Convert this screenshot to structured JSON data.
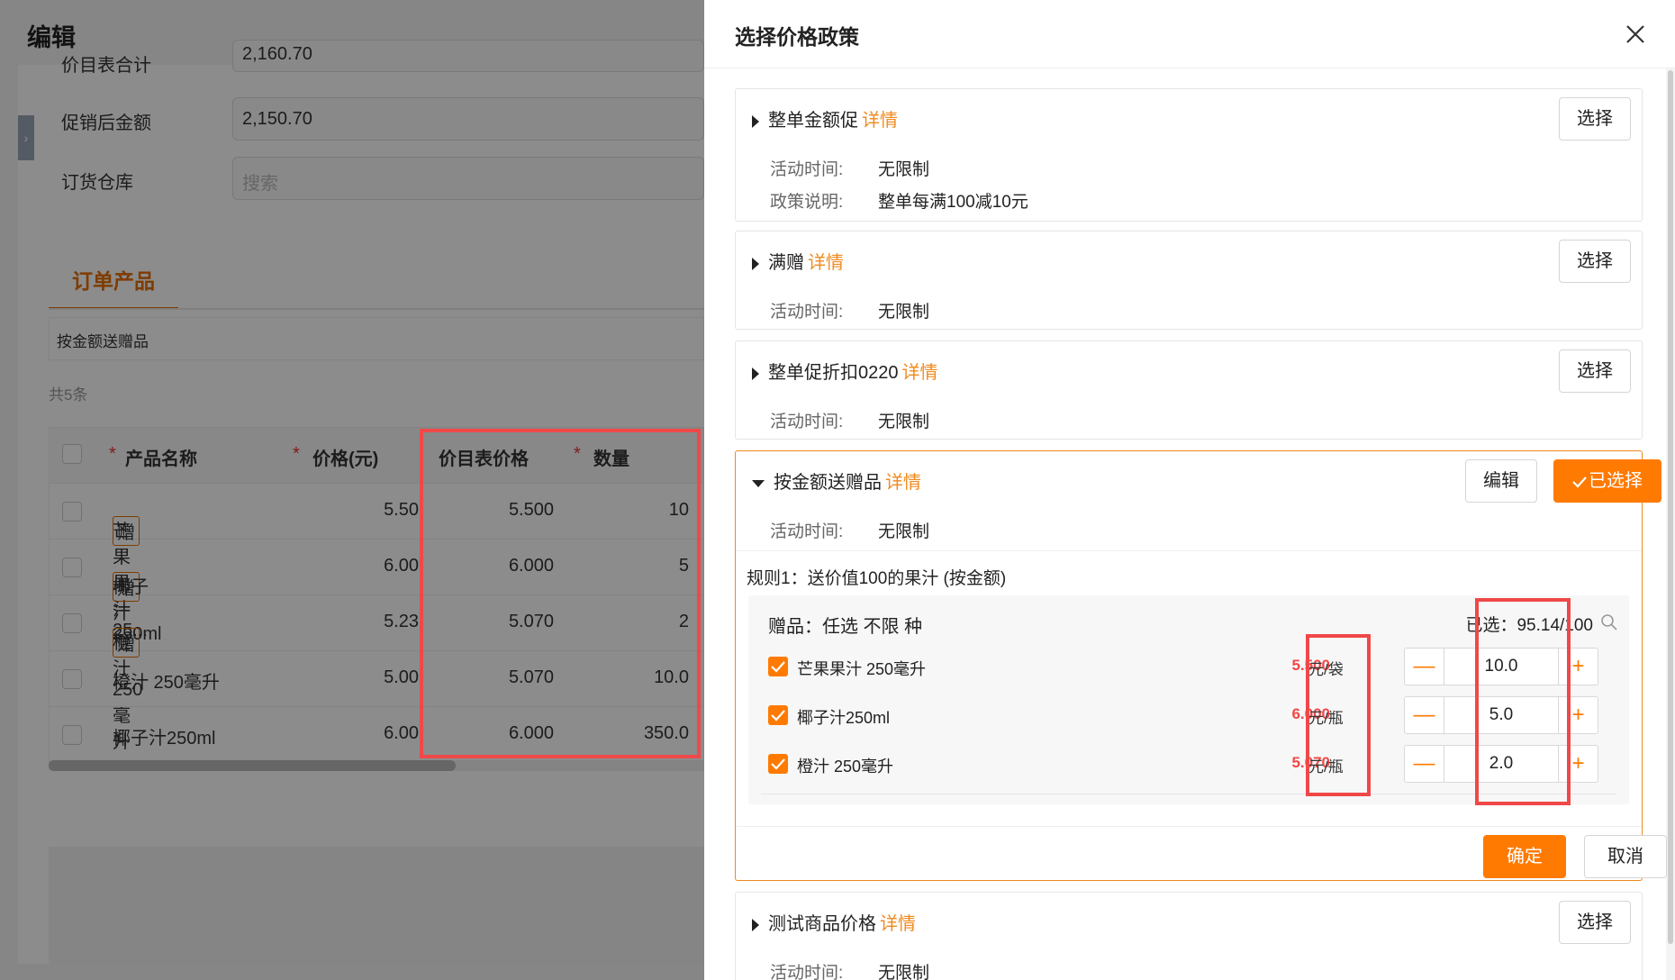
{
  "background": {
    "title": "编辑",
    "side_toggle": "›",
    "form": [
      {
        "label": "价目表合计",
        "value": "2,160.70"
      },
      {
        "label": "促销后金额",
        "value": "2,150.70"
      },
      {
        "label": "订货仓库",
        "placeholder": "搜索"
      }
    ],
    "tab": "订单产品",
    "filter_text": "按金额送赠品",
    "count": "共5条",
    "table": {
      "headers": {
        "name": "产品名称",
        "price": "价格(元)",
        "list_price": "价目表价格",
        "qty": "数量",
        "required_mark": "*"
      },
      "rows": [
        {
          "gift": "赠",
          "name": "芒果果汁 25...",
          "price": "5.50",
          "list_price": "5.500",
          "qty": "10"
        },
        {
          "gift": "赠",
          "name": "椰子汁250ml",
          "price": "6.00",
          "list_price": "6.000",
          "qty": "5"
        },
        {
          "gift": "赠",
          "name": "橙汁 250毫升",
          "price": "5.23",
          "list_price": "5.070",
          "qty": "2"
        },
        {
          "gift": "",
          "name": "橙汁 250毫升",
          "price": "5.00",
          "list_price": "5.070",
          "qty": "10.0"
        },
        {
          "gift": "",
          "name": "椰子汁250ml",
          "price": "6.00",
          "list_price": "6.000",
          "qty": "350.0"
        }
      ]
    }
  },
  "drawer": {
    "title": "选择价格政策",
    "detail_label": "详情",
    "select_label": "选择",
    "time_key": "活动时间:",
    "desc_key": "政策说明:",
    "policies": [
      {
        "name": "整单金额促",
        "time": "无限制",
        "desc": "整单每满100减10元"
      },
      {
        "name": "满赠",
        "time": "无限制"
      },
      {
        "name": "整单促折扣0220",
        "time": "无限制"
      },
      {
        "name": "按金额送赠品",
        "time": "无限制",
        "edit_label": "编辑",
        "selected_label": "已选择"
      },
      {
        "name": "测试商品价格",
        "time": "无限制"
      }
    ],
    "rule": {
      "title": "规则1：送价值100的果汁 (按金额)",
      "gift_header": "赠品：任选 不限 种",
      "selected_text": "已选：95.14/100",
      "items": [
        {
          "name": "芒果果汁 250毫升",
          "price": "5.500",
          "unit": "元/袋",
          "qty": "10.0"
        },
        {
          "name": "椰子汁250ml",
          "price": "6.000",
          "unit": "元/瓶",
          "qty": "5.0"
        },
        {
          "name": "橙汁 250毫升",
          "price": "5.070",
          "unit": "元/瓶",
          "qty": "2.0"
        }
      ],
      "confirm_label": "确定",
      "cancel_label": "取消"
    }
  }
}
